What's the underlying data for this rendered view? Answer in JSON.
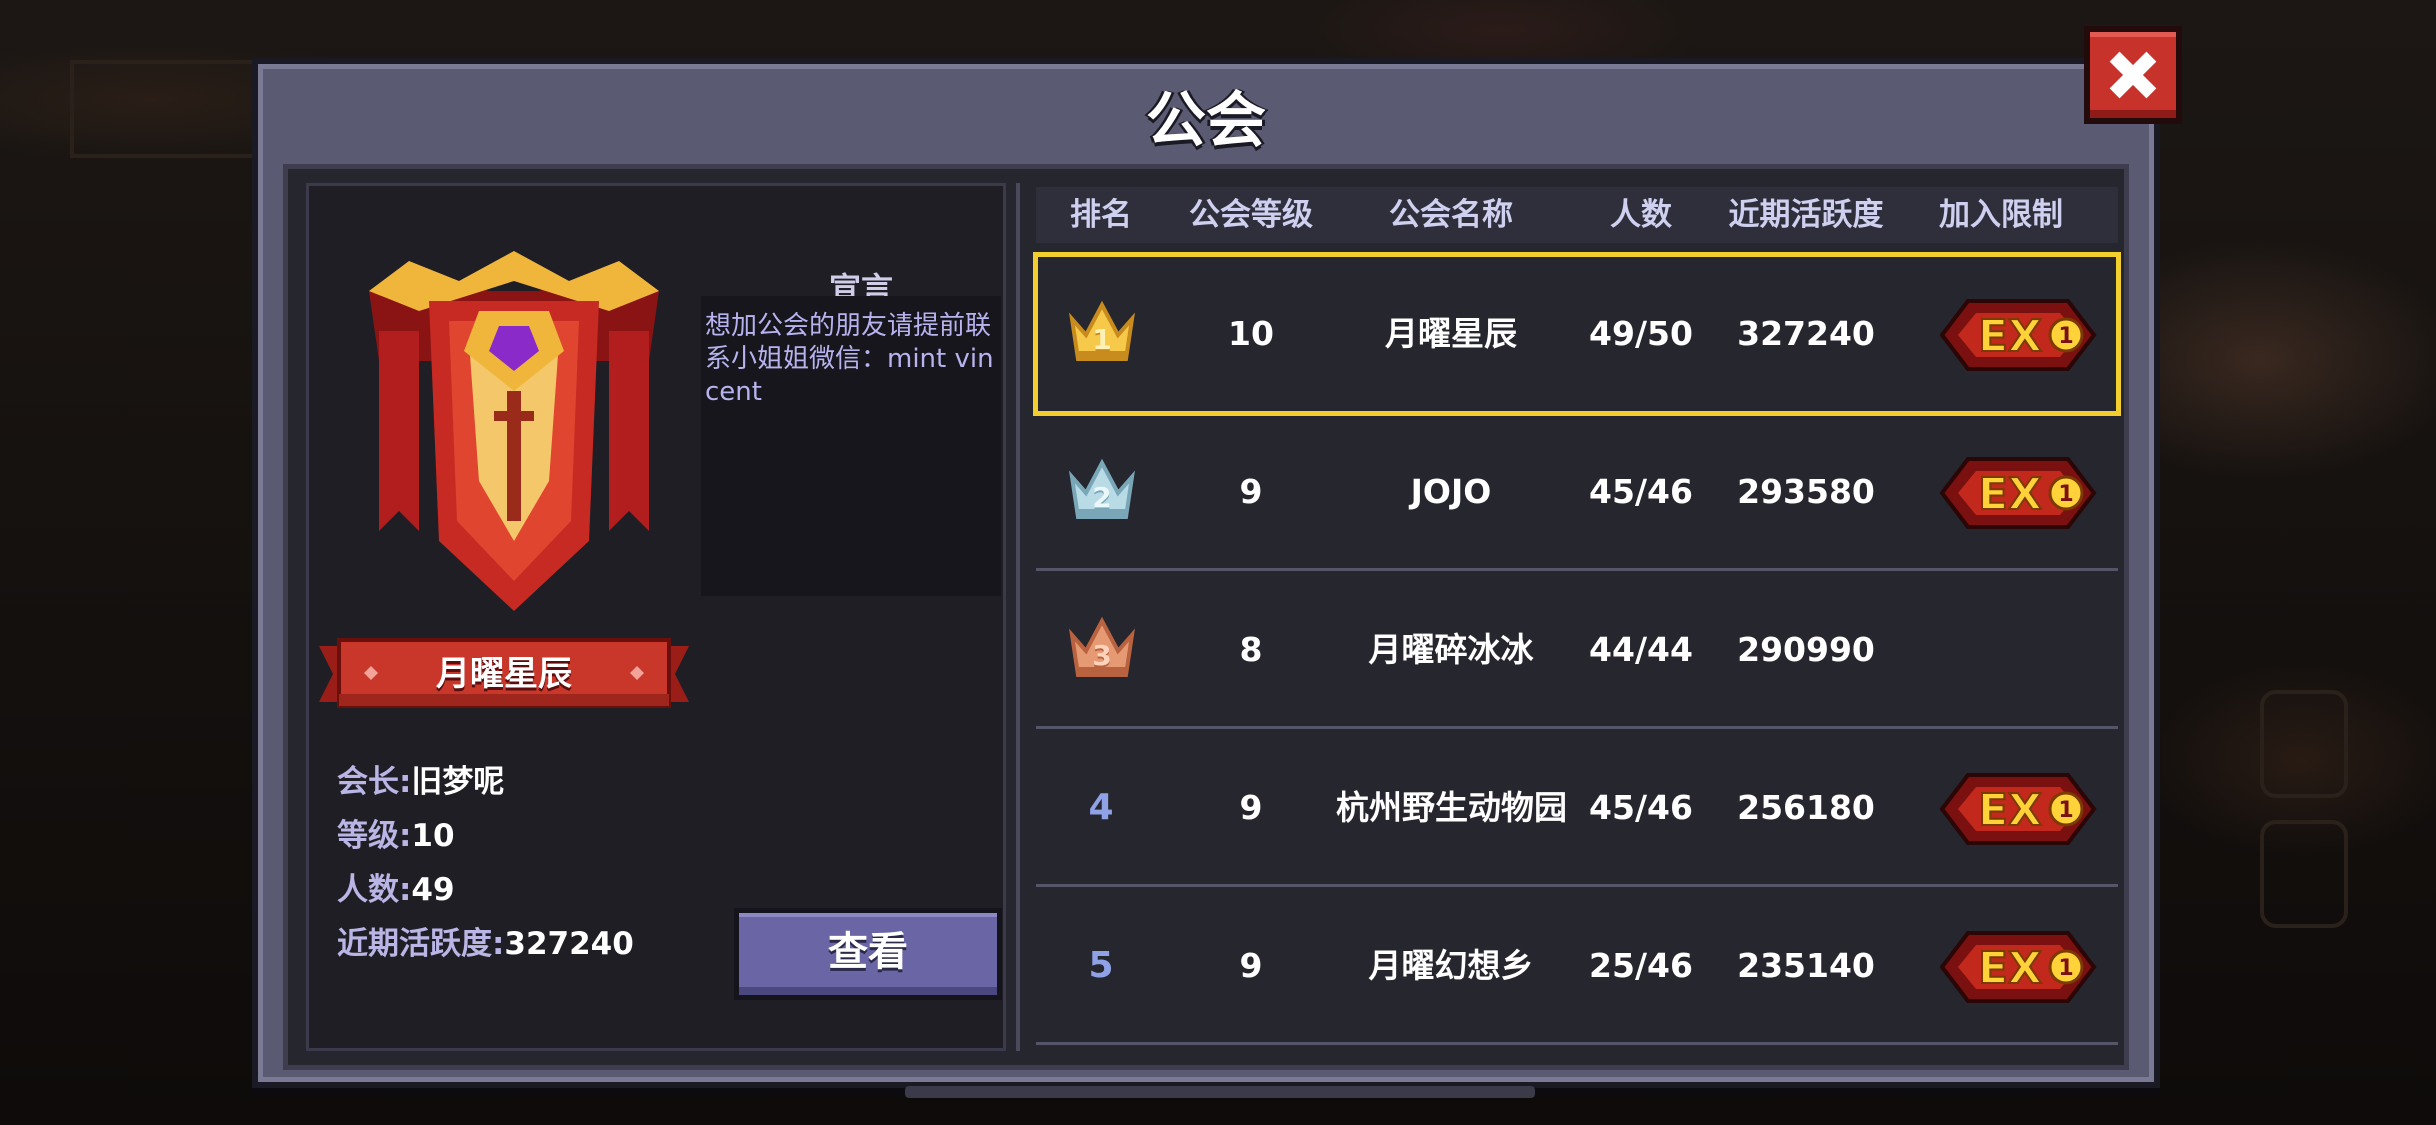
{
  "window": {
    "title": "公会"
  },
  "guild": {
    "name": "月曜星辰",
    "declaration_title": "宣言",
    "declaration": "想加公会的朋友请提前联系小姐姐微信：mint vincent",
    "leader_label": "会长:",
    "leader": "旧梦呢",
    "level_label": "等级:",
    "level": "10",
    "members_label": "人数:",
    "members": "49",
    "activity_label": "近期活跃度:",
    "activity": "327240",
    "view_button": "查看"
  },
  "table": {
    "headers": [
      "排名",
      "公会等级",
      "公会名称",
      "人数",
      "近期活跃度",
      "加入限制"
    ],
    "rows": [
      {
        "rank": "1",
        "crown": "gold-crown-icon",
        "level": "10",
        "name": "月曜星辰",
        "members": "49/50",
        "activity": "327240",
        "limit": "EX1",
        "limit_badge": true,
        "selected": true
      },
      {
        "rank": "2",
        "crown": "silver-crown-icon",
        "level": "9",
        "name": "JOJO",
        "members": "45/46",
        "activity": "293580",
        "limit": "EX1",
        "limit_badge": true
      },
      {
        "rank": "3",
        "crown": "bronze-crown-icon",
        "level": "8",
        "name": "月曜碎冰冰",
        "members": "44/44",
        "activity": "290990",
        "limit": "",
        "limit_badge": false
      },
      {
        "rank": "4",
        "crown": "",
        "level": "9",
        "name": "杭州野生动物园",
        "members": "45/46",
        "activity": "256180",
        "limit": "EX1",
        "limit_badge": true
      },
      {
        "rank": "5",
        "crown": "",
        "level": "9",
        "name": "月曜幻想乡",
        "members": "25/46",
        "activity": "235140",
        "limit": "EX1",
        "limit_badge": true
      }
    ]
  },
  "colors": {
    "accent_selected": "#f2cf2e",
    "button": "#6a66a6",
    "close": "#c7322b"
  },
  "icons": {
    "close": "close-icon",
    "emblem": "guild-emblem-icon",
    "limit": "ex-limit-icon"
  }
}
